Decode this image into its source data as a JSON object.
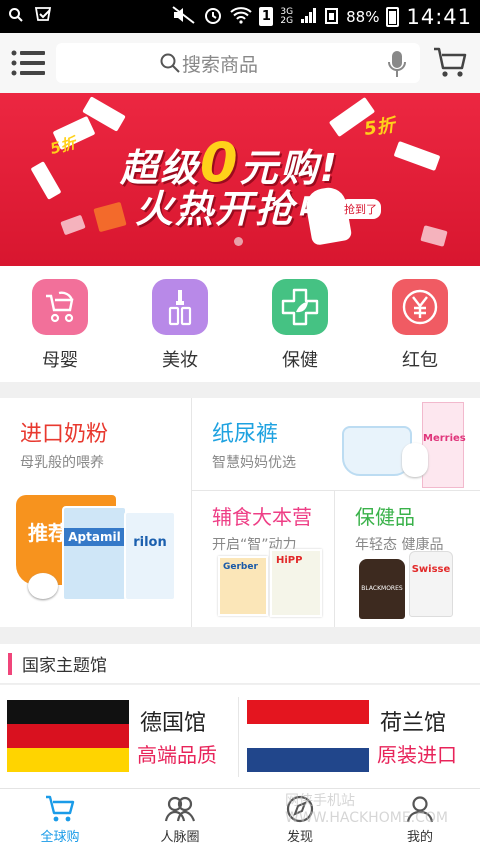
{
  "status_bar": {
    "battery": "88%",
    "time": "14:41",
    "network_a": "3G",
    "network_b": "2G",
    "sim": "1"
  },
  "header": {
    "search_placeholder": "搜索商品"
  },
  "banner": {
    "line1_prefix": "超级",
    "line1_zero": "0",
    "line1_suffix": "元购!",
    "line2": "火热开抢中",
    "badge": "5折",
    "sticker": "抢到了"
  },
  "categories": [
    {
      "label": "母婴",
      "color": "#f2709a"
    },
    {
      "label": "美妆",
      "color": "#b889e8"
    },
    {
      "label": "保健",
      "color": "#45c283"
    },
    {
      "label": "红包",
      "color": "#f05b63"
    }
  ],
  "promos": {
    "milk": {
      "title": "进口奶粉",
      "subtitle": "母乳般的喂养",
      "title_color": "#e8392f",
      "badge": "推荐",
      "product_a": "Aptamil",
      "product_b": "rilon"
    },
    "diaper": {
      "title": "纸尿裤",
      "subtitle": "智慧妈妈优选",
      "title_color": "#1ea2e0",
      "brand": "Merries"
    },
    "food": {
      "title": "辅食大本营",
      "subtitle": "开启“智”动力",
      "title_color": "#ee3f86",
      "brand_a": "Gerber",
      "brand_b": "HiPP"
    },
    "health": {
      "title": "保健品",
      "subtitle": "年轻态 健康品",
      "title_color": "#3ab24a",
      "brand_a": "BLACKMORES",
      "brand_b": "Swisse"
    }
  },
  "country_section": {
    "title": "国家主题馆",
    "items": [
      {
        "name": "德国馆",
        "tag": "高端品质"
      },
      {
        "name": "荷兰馆",
        "tag": "原装进口"
      }
    ]
  },
  "bottom_nav": [
    {
      "label": "全球购",
      "active": true
    },
    {
      "label": "人脉圈",
      "active": false
    },
    {
      "label": "发现",
      "active": false
    },
    {
      "label": "我的",
      "active": false
    }
  ],
  "watermark": "网侠手机站 WWW.HACKHOME.COM"
}
